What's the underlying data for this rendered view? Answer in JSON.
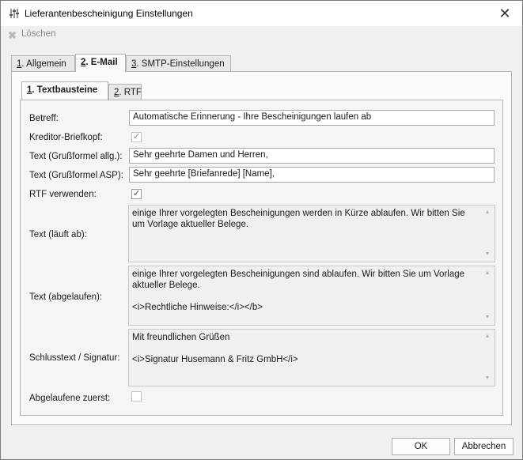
{
  "window": {
    "title": "Lieferantenbescheinigung Einstellungen"
  },
  "toolbar": {
    "delete_label": "Löschen"
  },
  "tabs": [
    {
      "num": "1",
      "label": ". Allgemein"
    },
    {
      "num": "2",
      "label": ". E-Mail"
    },
    {
      "num": "3",
      "label": ". SMTP-Einstellungen"
    }
  ],
  "subtabs": [
    {
      "num": "1",
      "label": ". Textbausteine"
    },
    {
      "num": "2",
      "label": ". RTF"
    }
  ],
  "form": {
    "betreff_label": "Betreff:",
    "betreff_value": "Automatische Erinnerung - Ihre Bescheinigungen laufen ab",
    "kreditor_label": "Kreditor-Briefkopf:",
    "gruss_allg_label": "Text (Grußformel allg.):",
    "gruss_allg_value": "Sehr geehrte Damen und Herren,",
    "gruss_asp_label": "Text (Grußformel ASP):",
    "gruss_asp_value": "Sehr geehrte [Briefanrede] [Name],",
    "rtf_label": "RTF verwenden:",
    "laeuft_ab_label": "Text (läuft ab):",
    "laeuft_ab_value": "einige Ihrer vorgelegten Bescheinigungen werden in Kürze ablaufen. Wir bitten Sie um Vorlage aktueller Belege.",
    "abgelaufen_label": "Text (abgelaufen):",
    "abgelaufen_value": "einige Ihrer vorgelegten Bescheinigungen sind ablaufen. Wir bitten Sie um Vorlage aktueller Belege.\n\n<i>Rechtliche Hinweise:</i></b>",
    "schluss_label": "Schlusstext / Signatur:",
    "schluss_value": "Mit freundlichen Grüßen\n\n<i>Signatur Husemann & Fritz GmbH</i>",
    "abgelaufene_zuerst_label": "Abgelaufene zuerst:",
    "kreditor_checked": true,
    "rtf_checked": true,
    "abgelaufene_zuerst_checked": false
  },
  "buttons": {
    "ok": "OK",
    "cancel": "Abbrechen"
  }
}
